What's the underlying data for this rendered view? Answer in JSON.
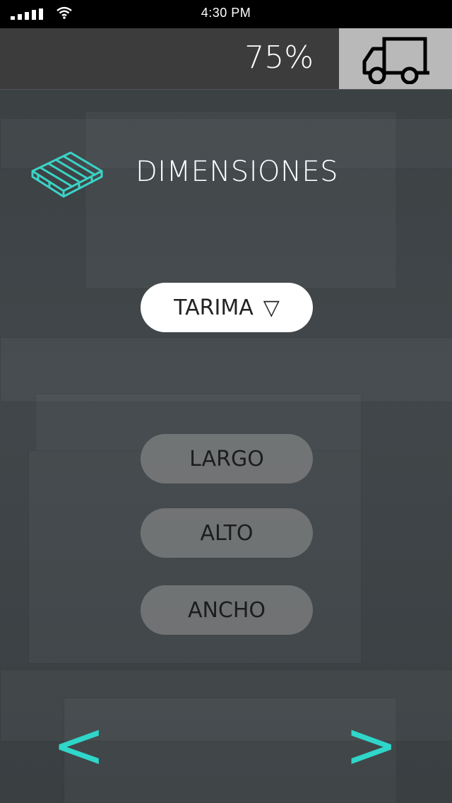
{
  "status_bar": {
    "time": "4:30 PM"
  },
  "top_bar": {
    "progress_text": "75%",
    "progress": 0.75,
    "truck_icon": "truck-icon"
  },
  "section": {
    "title": "DIMENSIONES",
    "icon": "pallet-icon"
  },
  "dropdown": {
    "selected": "TARIMA",
    "arrow": "▽"
  },
  "fields": {
    "largo": "LARGO",
    "alto": "ALTO",
    "ancho": "ANCHO"
  },
  "navigation": {
    "prev": "<",
    "next": ">"
  },
  "colors": {
    "accent": "#2fd6c9",
    "topbar": "#3c3c3c",
    "truck_button": "#b9b9b9"
  }
}
